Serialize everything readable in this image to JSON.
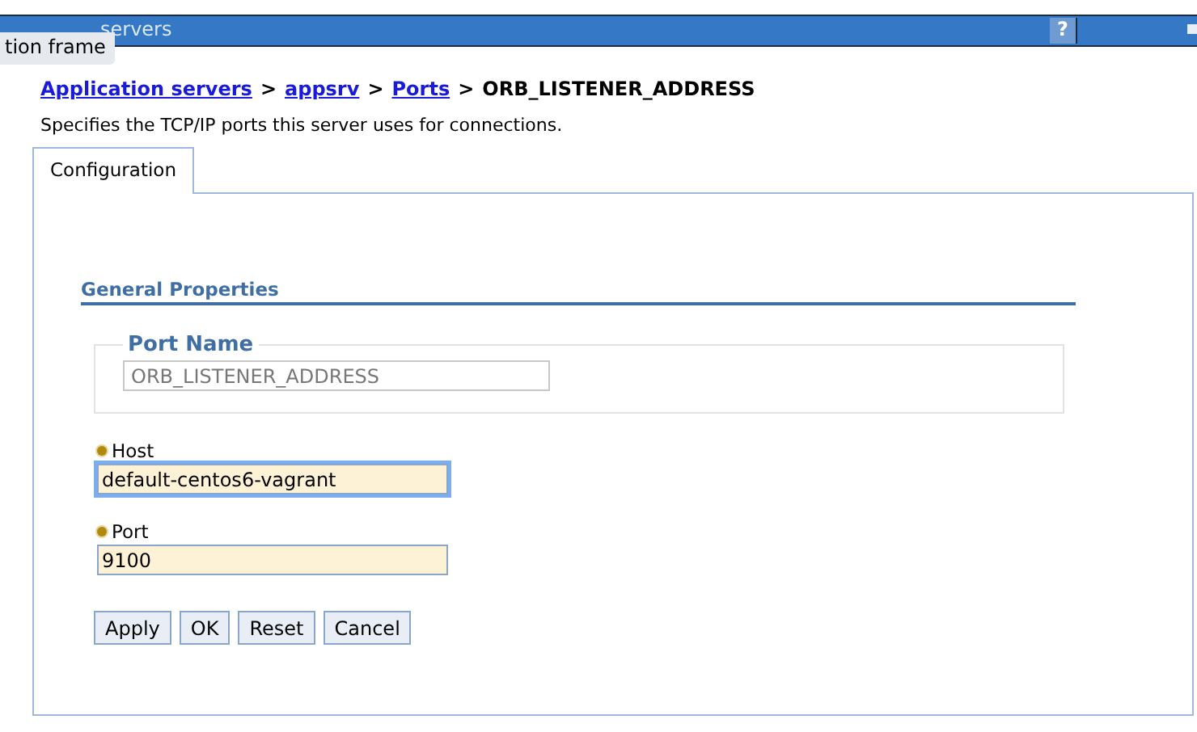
{
  "window": {
    "title": "servers",
    "help": "?",
    "tooltip": "tion frame"
  },
  "breadcrumb": {
    "links": [
      "Application servers",
      "appsrv",
      "Ports"
    ],
    "separator": ">",
    "current": "ORB_LISTENER_ADDRESS"
  },
  "description": "Specifies the TCP/IP ports this server uses for connections.",
  "tabs": [
    {
      "label": "Configuration",
      "selected": true
    }
  ],
  "section": {
    "title": "General Properties"
  },
  "port_name": {
    "legend": "Port Name",
    "value": "ORB_LISTENER_ADDRESS",
    "disabled": true
  },
  "fields": [
    {
      "label": "Host",
      "value": "default-centos6-vagrant",
      "required": true,
      "focused": true
    },
    {
      "label": "Port",
      "value": "9100",
      "required": true,
      "focused": false
    }
  ],
  "buttons": [
    "Apply",
    "OK",
    "Reset",
    "Cancel"
  ]
}
